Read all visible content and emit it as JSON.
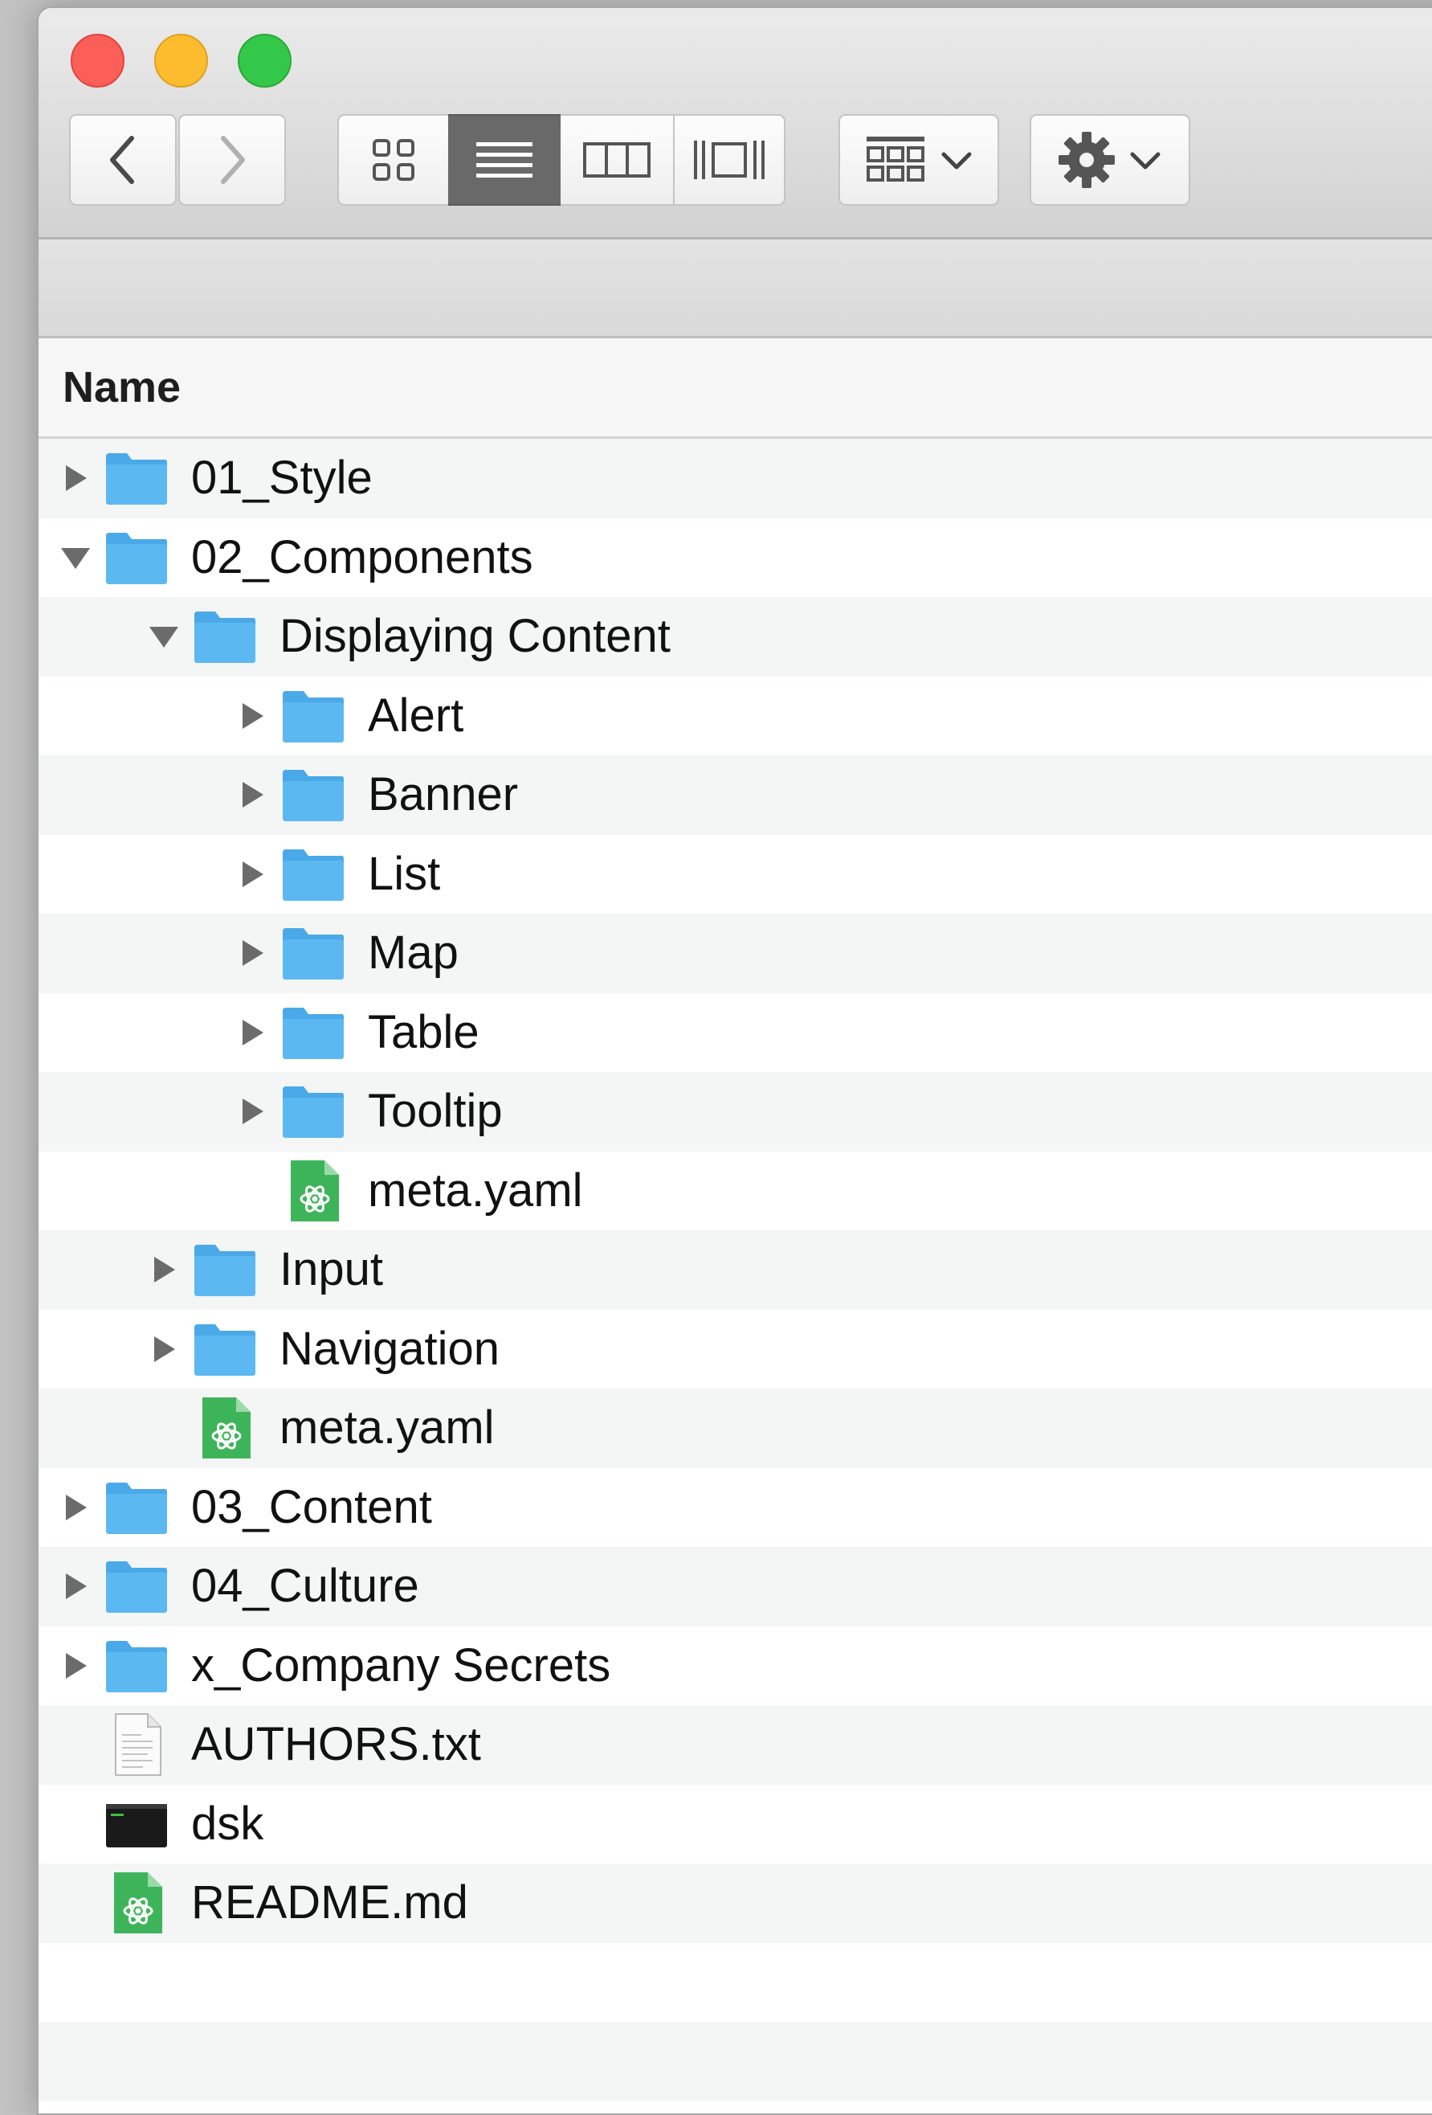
{
  "window": {
    "traffic_lights": [
      "close",
      "minimize",
      "zoom"
    ]
  },
  "toolbar": {
    "back_icon": "chevron-left-icon",
    "forward_icon": "chevron-right-icon",
    "view_modes": [
      "icon-view",
      "list-view",
      "column-view",
      "cover-flow-view"
    ],
    "active_view": "list-view",
    "arrange_icon": "arrange-grid-icon",
    "action_icon": "gear-icon"
  },
  "list": {
    "column_header": "Name",
    "rows": [
      {
        "label": "01_Style",
        "kind": "folder",
        "disclosure": "collapsed",
        "depth": 0
      },
      {
        "label": "02_Components",
        "kind": "folder",
        "disclosure": "expanded",
        "depth": 0
      },
      {
        "label": "Displaying Content",
        "kind": "folder",
        "disclosure": "expanded",
        "depth": 1
      },
      {
        "label": "Alert",
        "kind": "folder",
        "disclosure": "collapsed",
        "depth": 2
      },
      {
        "label": "Banner",
        "kind": "folder",
        "disclosure": "collapsed",
        "depth": 2
      },
      {
        "label": "List",
        "kind": "folder",
        "disclosure": "collapsed",
        "depth": 2
      },
      {
        "label": "Map",
        "kind": "folder",
        "disclosure": "collapsed",
        "depth": 2
      },
      {
        "label": "Table",
        "kind": "folder",
        "disclosure": "collapsed",
        "depth": 2
      },
      {
        "label": "Tooltip",
        "kind": "folder",
        "disclosure": "collapsed",
        "depth": 2
      },
      {
        "label": "meta.yaml",
        "kind": "atom-file",
        "disclosure": "none",
        "depth": 2
      },
      {
        "label": "Input",
        "kind": "folder",
        "disclosure": "collapsed",
        "depth": 1
      },
      {
        "label": "Navigation",
        "kind": "folder",
        "disclosure": "collapsed",
        "depth": 1
      },
      {
        "label": "meta.yaml",
        "kind": "atom-file",
        "disclosure": "none",
        "depth": 1
      },
      {
        "label": "03_Content",
        "kind": "folder",
        "disclosure": "collapsed",
        "depth": 0
      },
      {
        "label": "04_Culture",
        "kind": "folder",
        "disclosure": "collapsed",
        "depth": 0
      },
      {
        "label": "x_Company Secrets",
        "kind": "folder",
        "disclosure": "collapsed",
        "depth": 0
      },
      {
        "label": "AUTHORS.txt",
        "kind": "text-file",
        "disclosure": "none",
        "depth": 0
      },
      {
        "label": "dsk",
        "kind": "terminal-exec",
        "disclosure": "none",
        "depth": 0
      },
      {
        "label": "README.md",
        "kind": "atom-file",
        "disclosure": "none",
        "depth": 0
      }
    ]
  },
  "colors": {
    "folder_blue": "#5cb8f0",
    "atom_green": "#3eb45a",
    "active_segment": "#696969"
  }
}
